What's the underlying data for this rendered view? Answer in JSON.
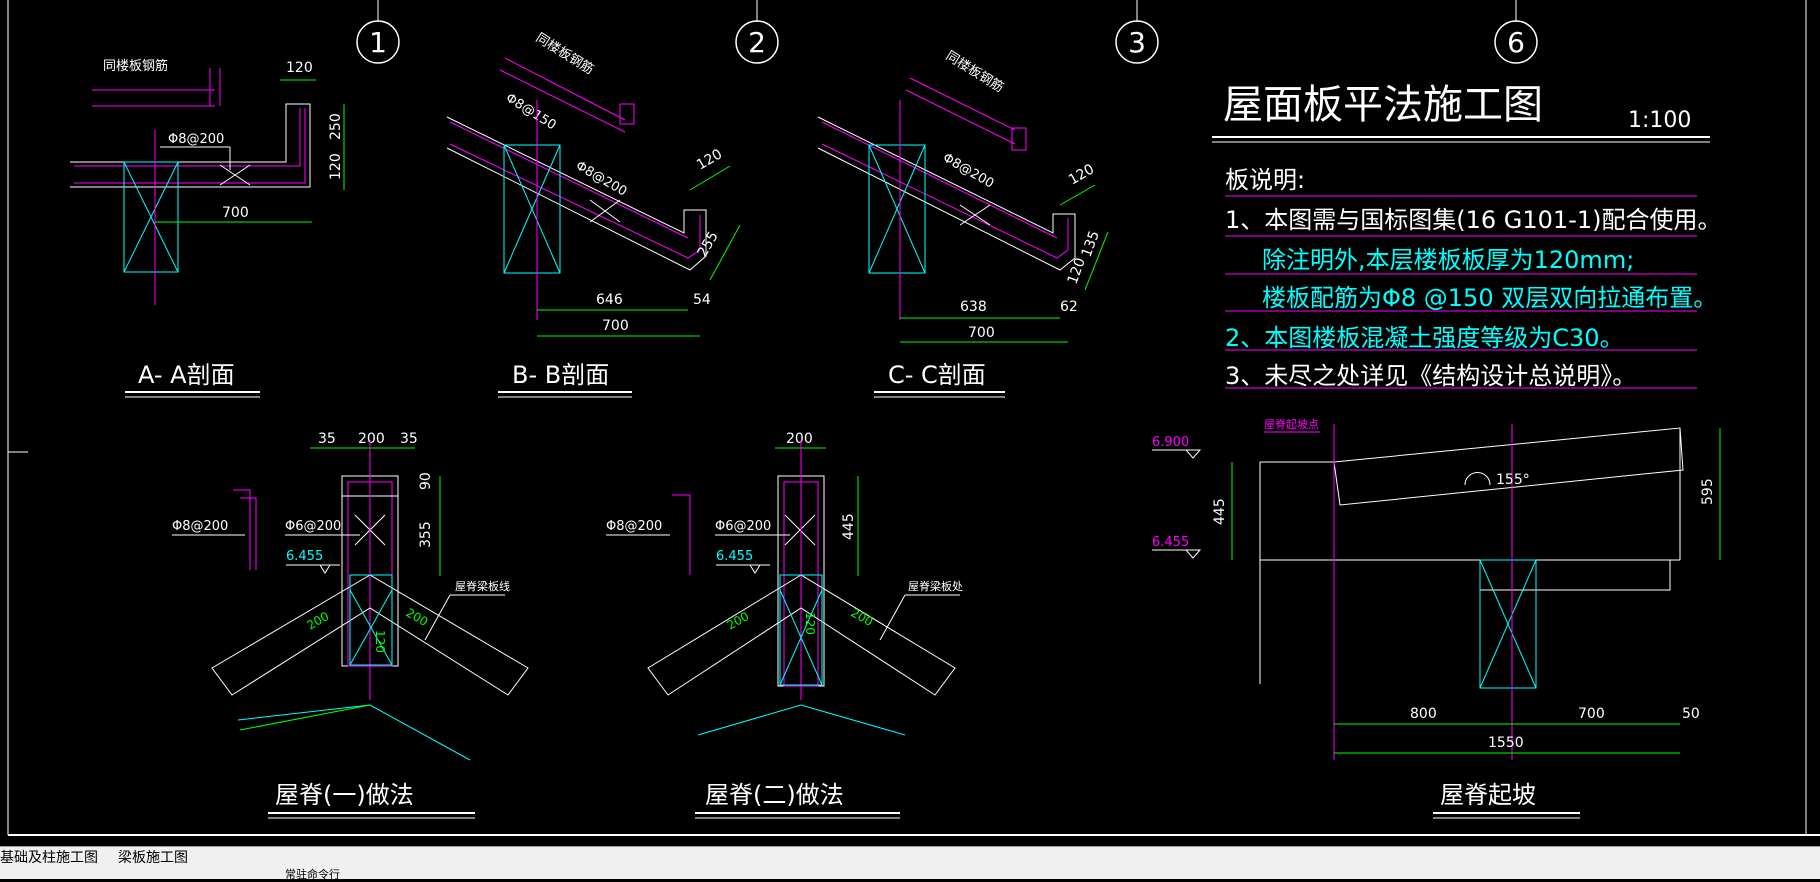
{
  "colors": {
    "green": "#00ff00",
    "cyan": "#00ffff",
    "magenta": "#ff00ff",
    "white": "#ffffff",
    "bg": "#000000"
  },
  "axis_labels": [
    "1",
    "2",
    "3",
    "6"
  ],
  "title": {
    "text": "屋面板平法施工图",
    "scale": "1:100"
  },
  "notes": {
    "header": "板说明:",
    "line1": "1、本图需与国标图集(16 G101-1)配合使用。",
    "line2": "除注明外,本层楼板板厚为120mm;",
    "line3": "楼板配筋为Φ8 @150 双层双向拉通布置。",
    "line4": "2、本图楼板混凝土强度等级为C30。",
    "line5": "3、未尽之处详见《结构设计总说明》。"
  },
  "sections": {
    "aa": {
      "title": "A- A剖面",
      "rebar_label": "同楼板钢筋",
      "rebar": "Φ8@200",
      "dim_top": "120",
      "dim_250": "250",
      "dim_120": "120",
      "dim_700": "700"
    },
    "bb": {
      "title": "B- B剖面",
      "rebar_label": "同楼板钢筋",
      "rebar1": "Φ8@150",
      "rebar2": "Φ8@200",
      "dim_120": "120",
      "dim_255": "255",
      "dim_646": "646",
      "dim_54": "54",
      "dim_700": "700"
    },
    "cc": {
      "title": "C- C剖面",
      "rebar_label": "同楼板钢筋",
      "rebar": "Φ8@200",
      "dim_120a": "120",
      "dim_135": "135",
      "dim_120b": "120",
      "dim_638": "638",
      "dim_62": "62",
      "dim_700": "700"
    }
  },
  "ridge1": {
    "title": "屋脊(一)做法",
    "dim_35a": "35",
    "dim_200": "200",
    "dim_35b": "35",
    "dim_90": "90",
    "dim_355": "355",
    "rebar_left": "Φ8@200",
    "rebar_right": "Φ6@200",
    "elev": "6.455",
    "note": "屋脊梁板线",
    "dim_l": "200",
    "dim_m": "120",
    "dim_r": "200"
  },
  "ridge2": {
    "title": "屋脊(二)做法",
    "dim_200": "200",
    "dim_445": "445",
    "rebar_left": "Φ8@200",
    "rebar_right": "Φ6@200",
    "elev": "6.455",
    "note": "屋脊梁板处",
    "dim_l": "200",
    "dim_m": "120",
    "dim_r": "200"
  },
  "rise": {
    "title": "屋脊起坡",
    "label": "屋脊起坡点",
    "elev_top": "6.900",
    "elev_bottom": "6.455",
    "dim_445": "445",
    "dim_595": "595",
    "angle": "155°",
    "dim_800": "800",
    "dim_700": "700",
    "dim_50": "50",
    "dim_1550": "1550"
  },
  "tabs": {
    "tab1": "基础及柱施工图",
    "tab2": "梁板施工图"
  },
  "status": "常驻命令行"
}
